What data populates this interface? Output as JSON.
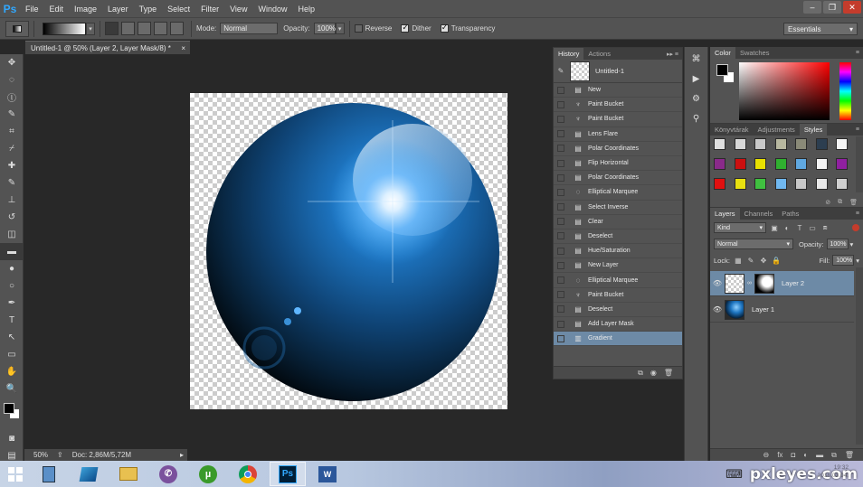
{
  "app": {
    "logo": "Ps",
    "menu": [
      "File",
      "Edit",
      "Image",
      "Layer",
      "Type",
      "Select",
      "Filter",
      "View",
      "Window",
      "Help"
    ],
    "window_controls": [
      "–",
      "❐",
      "✕"
    ]
  },
  "options_bar": {
    "mode_label": "Mode:",
    "mode_value": "Normal",
    "opacity_label": "Opacity:",
    "opacity_value": "100%",
    "reverse_label": "Reverse",
    "reverse_checked": false,
    "dither_label": "Dither",
    "dither_checked": true,
    "transparency_label": "Transparency",
    "transparency_checked": true,
    "workspace": "Essentials"
  },
  "document": {
    "tab_title": "Untitled-1 @ 50% (Layer 2, Layer Mask/8) *",
    "close": "×",
    "zoom": "50%",
    "doc_info": "Doc: 2,86M/5,72M"
  },
  "tools": [
    "move-tool",
    "marquee-tool",
    "lasso-tool",
    "quick-select-tool",
    "crop-tool",
    "eyedropper-tool",
    "healing-tool",
    "brush-tool",
    "clone-stamp-tool",
    "history-brush-tool",
    "eraser-tool",
    "gradient-tool",
    "blur-tool",
    "dodge-tool",
    "pen-tool",
    "type-tool",
    "path-select-tool",
    "shape-tool",
    "hand-tool",
    "zoom-tool"
  ],
  "tool_glyphs": [
    "✥",
    "◌",
    "ⓛ",
    "✎",
    "⌗",
    "⌿",
    "✚",
    "✎",
    "⊥",
    "↺",
    "◫",
    "▬",
    "●",
    "○",
    "✒",
    "T",
    "↖",
    "▭",
    "✋",
    "🔍"
  ],
  "history": {
    "tabs": [
      "History",
      "Actions"
    ],
    "snapshot": "Untitled-1",
    "states": [
      "New",
      "Paint Bucket",
      "Paint Bucket",
      "Lens Flare",
      "Polar Coordinates",
      "Flip Horizontal",
      "Polar Coordinates",
      "Elliptical Marquee",
      "Select Inverse",
      "Clear",
      "Deselect",
      "Hue/Saturation",
      "New Layer",
      "Elliptical Marquee",
      "Paint Bucket",
      "Deselect",
      "Add Layer Mask",
      "Gradient"
    ],
    "state_icons": [
      "doc-icon",
      "bucket-icon",
      "bucket-icon",
      "doc-icon",
      "doc-icon",
      "doc-icon",
      "doc-icon",
      "marquee-icon",
      "doc-icon",
      "doc-icon",
      "doc-icon",
      "doc-icon",
      "doc-icon",
      "marquee-icon",
      "bucket-icon",
      "doc-icon",
      "doc-icon",
      "gradient-icon"
    ],
    "selected_index": 17
  },
  "color_panel": {
    "tabs": [
      "Color",
      "Swatches"
    ],
    "foreground": "#000000",
    "background": "#ffffff"
  },
  "styles_panel": {
    "tabs": [
      "Könyvtárak",
      "Adjustments",
      "Styles"
    ],
    "swatches": [
      "#e0e0e0",
      "#d8d8d8",
      "#c8c8c8",
      "#b8b8a0",
      "#8a8a78",
      "#2c3e50",
      "#f4f4f4",
      "#8a2a8a",
      "#cc1010",
      "#e8e000",
      "#30b030",
      "#60a8e0",
      "#f4f4f4",
      "#9020a0",
      "#e01010",
      "#e8e010",
      "#40c040",
      "#70b8f0",
      "#c8c8c8",
      "#e8e8e8",
      "#d0d0d0"
    ]
  },
  "layers_panel": {
    "tabs": [
      "Layers",
      "Channels",
      "Paths"
    ],
    "filter": "Kind",
    "blend_mode": "Normal",
    "opacity_label": "Opacity:",
    "opacity_value": "100%",
    "lock_label": "Lock:",
    "fill_label": "Fill:",
    "fill_value": "100%",
    "layers": [
      {
        "name": "Layer 2",
        "active": true
      },
      {
        "name": "Layer 1",
        "active": false
      }
    ]
  },
  "taskbar": {
    "apps": [
      "calculator",
      "app-blue",
      "file-explorer",
      "viber",
      "utorrent",
      "chrome",
      "photoshop",
      "word"
    ],
    "active_app": "photoshop",
    "watermark": "pxleyes.com",
    "clock_time": "19:32",
    "clock_date": "2016.03.04."
  }
}
